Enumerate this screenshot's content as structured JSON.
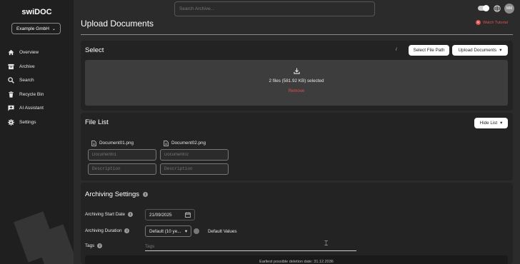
{
  "brand": "swiDOC",
  "company_selector": {
    "value": "Example GmbH"
  },
  "sidebar": {
    "items": [
      {
        "label": "Overview",
        "icon": "home-icon"
      },
      {
        "label": "Archive",
        "icon": "archive-icon"
      },
      {
        "label": "Search",
        "icon": "search-icon"
      },
      {
        "label": "Recycle Bin",
        "icon": "trash-icon"
      },
      {
        "label": "AI Assistant",
        "icon": "chat-plus-icon"
      },
      {
        "label": "Settings",
        "icon": "gear-icon"
      }
    ]
  },
  "topbar": {
    "search_placeholder": "Search Archive...",
    "avatar_initials": "MM"
  },
  "page": {
    "title": "Upload Documents",
    "tutorial_label": "Watch Tutorial"
  },
  "select_section": {
    "title": "Select",
    "path_separator": "/",
    "select_path_label": "Select File Path",
    "upload_label": "Upload Documents",
    "selected_text": "2 files (581.92 KB) selected",
    "remove_label": "Remove"
  },
  "file_list": {
    "title": "File List",
    "hide_label": "Hide List",
    "files": [
      {
        "name": "Document01.png",
        "title_placeholder": "Document01",
        "description_placeholder": "Description"
      },
      {
        "name": "Document02.png",
        "title_placeholder": "Document02",
        "description_placeholder": "Description"
      }
    ]
  },
  "archiving": {
    "title": "Archiving Settings",
    "start_date_label": "Archiving Start Date",
    "start_date_value": "21/09/2025",
    "duration_label": "Archiving Duration",
    "duration_value": "Default (10 ye...",
    "default_values_label": "Default Values",
    "tags_label": "Tags",
    "tags_placeholder": "Tags",
    "deletion_text": "Earliest possible deletion date: 31.12.2036"
  },
  "colors": {
    "background": "#2b2b2b",
    "sidebar": "#1f1f1f",
    "panel": "#232323",
    "danger": "#e05050"
  }
}
